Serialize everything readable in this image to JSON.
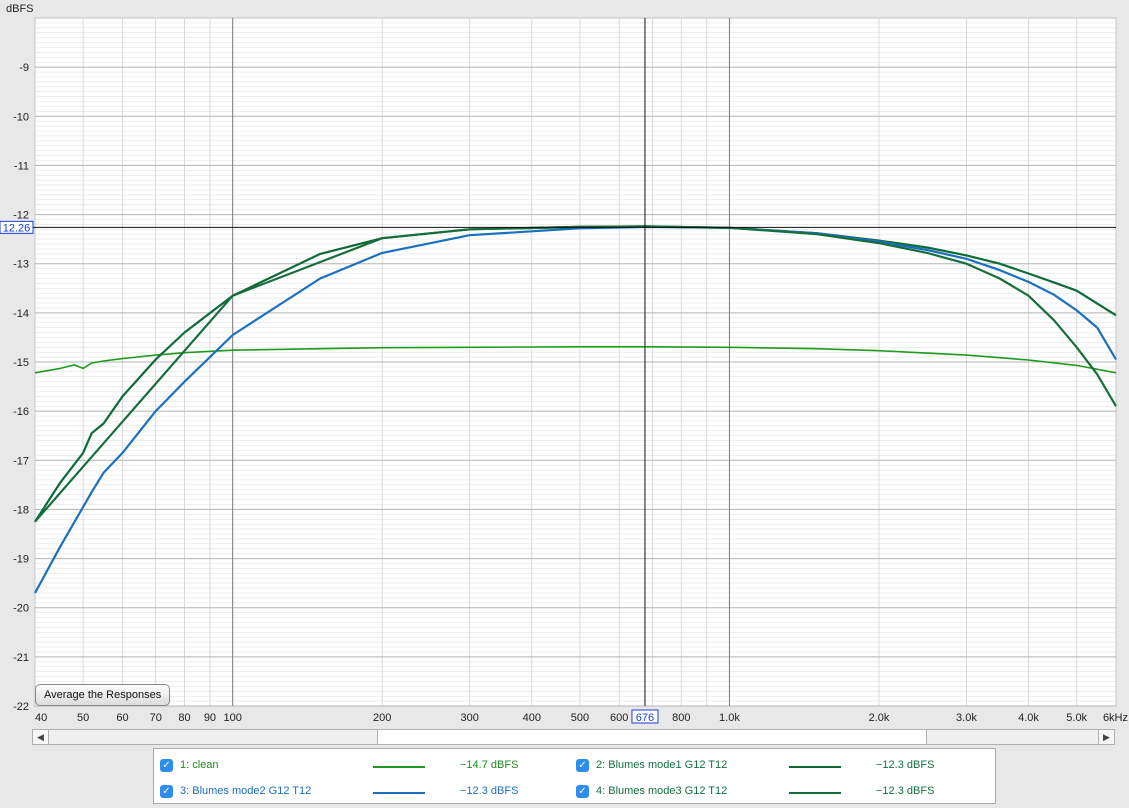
{
  "chart_data": {
    "type": "line",
    "ylabel": "dBFS",
    "y_scale": "linear",
    "ylim": [
      -22,
      -8
    ],
    "x_scale": "log",
    "xlim": [
      40,
      6000
    ],
    "ytick_labels": [
      "-9",
      "-10",
      "-11",
      "-12",
      "-13",
      "-14",
      "-15",
      "-16",
      "-17",
      "-18",
      "-19",
      "-20",
      "-21",
      "-22"
    ],
    "ytick_values": [
      -9,
      -10,
      -11,
      -12,
      -13,
      -14,
      -15,
      -16,
      -17,
      -18,
      -19,
      -20,
      -21,
      -22
    ],
    "xtick_labels": [
      "40",
      "50",
      "60",
      "70",
      "80",
      "90",
      "100",
      "200",
      "300",
      "400",
      "500",
      "600",
      "800",
      "1.0k",
      "2.0k",
      "3.0k",
      "4.0k",
      "5.0k",
      "6kHz"
    ],
    "xtick_values": [
      40,
      50,
      60,
      70,
      80,
      90,
      100,
      200,
      300,
      400,
      500,
      600,
      800,
      1000,
      2000,
      3000,
      4000,
      5000,
      6000
    ],
    "grid": true,
    "cursor": {
      "x": 676,
      "y": -12.26,
      "x_label": "676",
      "y_label": "12.26"
    },
    "series": [
      {
        "name": "1: clean",
        "color": "#1e9b1e",
        "readout": "−14.7 dBFS",
        "x": [
          40,
          45,
          48,
          50,
          52,
          55,
          60,
          70,
          80,
          100,
          150,
          200,
          300,
          500,
          676,
          1000,
          1500,
          2000,
          3000,
          4000,
          5000,
          6000
        ],
        "y": [
          -15.22,
          -15.13,
          -15.06,
          -15.13,
          -15.02,
          -14.98,
          -14.93,
          -14.86,
          -14.81,
          -14.76,
          -14.73,
          -14.71,
          -14.7,
          -14.69,
          -14.69,
          -14.7,
          -14.73,
          -14.77,
          -14.86,
          -14.96,
          -15.07,
          -15.22
        ]
      },
      {
        "name": "2: Blumes mode1 G12 T12",
        "color": "#0d6b3a",
        "readout": "−12.3 dBFS",
        "x": [
          40,
          45,
          50,
          52,
          55,
          60,
          70,
          80,
          100,
          150,
          200,
          300,
          500,
          676,
          1000,
          1500,
          2000,
          2500,
          3000,
          3500,
          4000,
          4500,
          5000,
          6000
        ],
        "y": [
          -18.25,
          -17.45,
          -16.85,
          -16.45,
          -16.25,
          -15.7,
          -14.95,
          -14.4,
          -13.65,
          -12.8,
          -12.48,
          -12.3,
          -12.25,
          -12.24,
          -12.27,
          -12.38,
          -12.53,
          -12.67,
          -12.83,
          -13.0,
          -13.2,
          -13.38,
          -13.55,
          -14.05
        ]
      },
      {
        "name": "3: Blumes mode2 G12 T12",
        "color": "#1a6fbf",
        "readout": "−12.3 dBFS",
        "x": [
          40,
          45,
          50,
          52,
          55,
          60,
          70,
          80,
          100,
          150,
          200,
          300,
          500,
          676,
          1000,
          1500,
          2000,
          2500,
          3000,
          3500,
          4000,
          4500,
          5000,
          5500,
          6000
        ],
        "y": [
          -19.7,
          -18.75,
          -17.95,
          -17.65,
          -17.25,
          -16.85,
          -16.0,
          -15.4,
          -14.45,
          -13.3,
          -12.78,
          -12.42,
          -12.28,
          -12.25,
          -12.27,
          -12.38,
          -12.55,
          -12.72,
          -12.9,
          -13.13,
          -13.37,
          -13.63,
          -13.95,
          -14.3,
          -14.95
        ]
      },
      {
        "name": "4: Blumes mode3 G12 T12",
        "color": "#176e3c",
        "readout": "−12.3 dBFS",
        "x": [
          40,
          100,
          200,
          300,
          500,
          676,
          1000,
          1500,
          2000,
          2500,
          3000,
          3500,
          4000,
          4500,
          5000,
          5500,
          6000
        ],
        "y": [
          -18.25,
          -13.65,
          -12.48,
          -12.3,
          -12.25,
          -12.24,
          -12.27,
          -12.4,
          -12.58,
          -12.78,
          -13.0,
          -13.3,
          -13.65,
          -14.15,
          -14.7,
          -15.25,
          -15.9
        ]
      }
    ]
  },
  "controls": {
    "average_button": "Average the Responses",
    "scroll_left_arrow": "◀",
    "scroll_right_arrow": "▶"
  },
  "legend": {
    "items": [
      {
        "label": "1: clean",
        "value": "−14.7 dBFS",
        "color": "#1e9b1e",
        "label_color": "#1e8a1e",
        "checked": true
      },
      {
        "label": "2: Blumes mode1 G12 T12",
        "value": "−12.3 dBFS",
        "color": "#0d6b3a",
        "label_color": "#137040",
        "checked": true
      },
      {
        "label": "3: Blumes mode2 G12 T12",
        "value": "−12.3 dBFS",
        "color": "#1a6fbf",
        "label_color": "#1a6fbf",
        "checked": true
      },
      {
        "label": "4: Blumes mode3 G12 T12",
        "value": "−12.3 dBFS",
        "color": "#176e3c",
        "label_color": "#137040",
        "checked": true
      }
    ]
  }
}
